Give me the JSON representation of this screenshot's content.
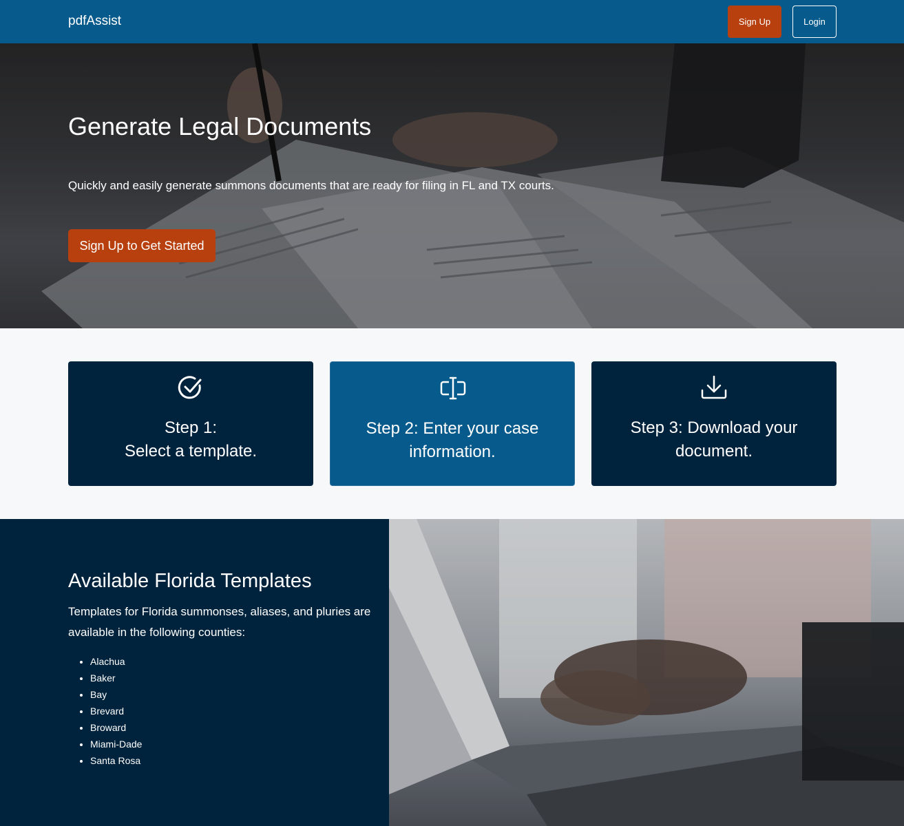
{
  "nav": {
    "brand": "pdfAssist",
    "signup_label": "Sign Up",
    "login_label": "Login"
  },
  "hero": {
    "title": "Generate Legal Documents",
    "subtitle": "Quickly and easily generate summons documents that are ready for filing in FL and TX courts.",
    "cta_label": "Sign Up to Get Started"
  },
  "steps": [
    {
      "line1": "Step 1:",
      "line2": "Select a template.",
      "icon": "check-circle-icon"
    },
    {
      "line1": "Step 2: Enter your case",
      "line2": "information.",
      "icon": "text-cursor-input-icon"
    },
    {
      "line1": "Step 3: Download your",
      "line2": "document.",
      "icon": "download-icon"
    }
  ],
  "templates": {
    "title": "Available Florida Templates",
    "description": "Templates for Florida summonses, aliases, and pluries are available in the following counties:",
    "counties": [
      "Alachua",
      "Baker",
      "Bay",
      "Brevard",
      "Broward",
      "Miami-Dade",
      "Santa Rosa"
    ]
  },
  "colors": {
    "navbar": "#075a8c",
    "accent": "#b8400e",
    "dark_navy": "#00233d"
  }
}
